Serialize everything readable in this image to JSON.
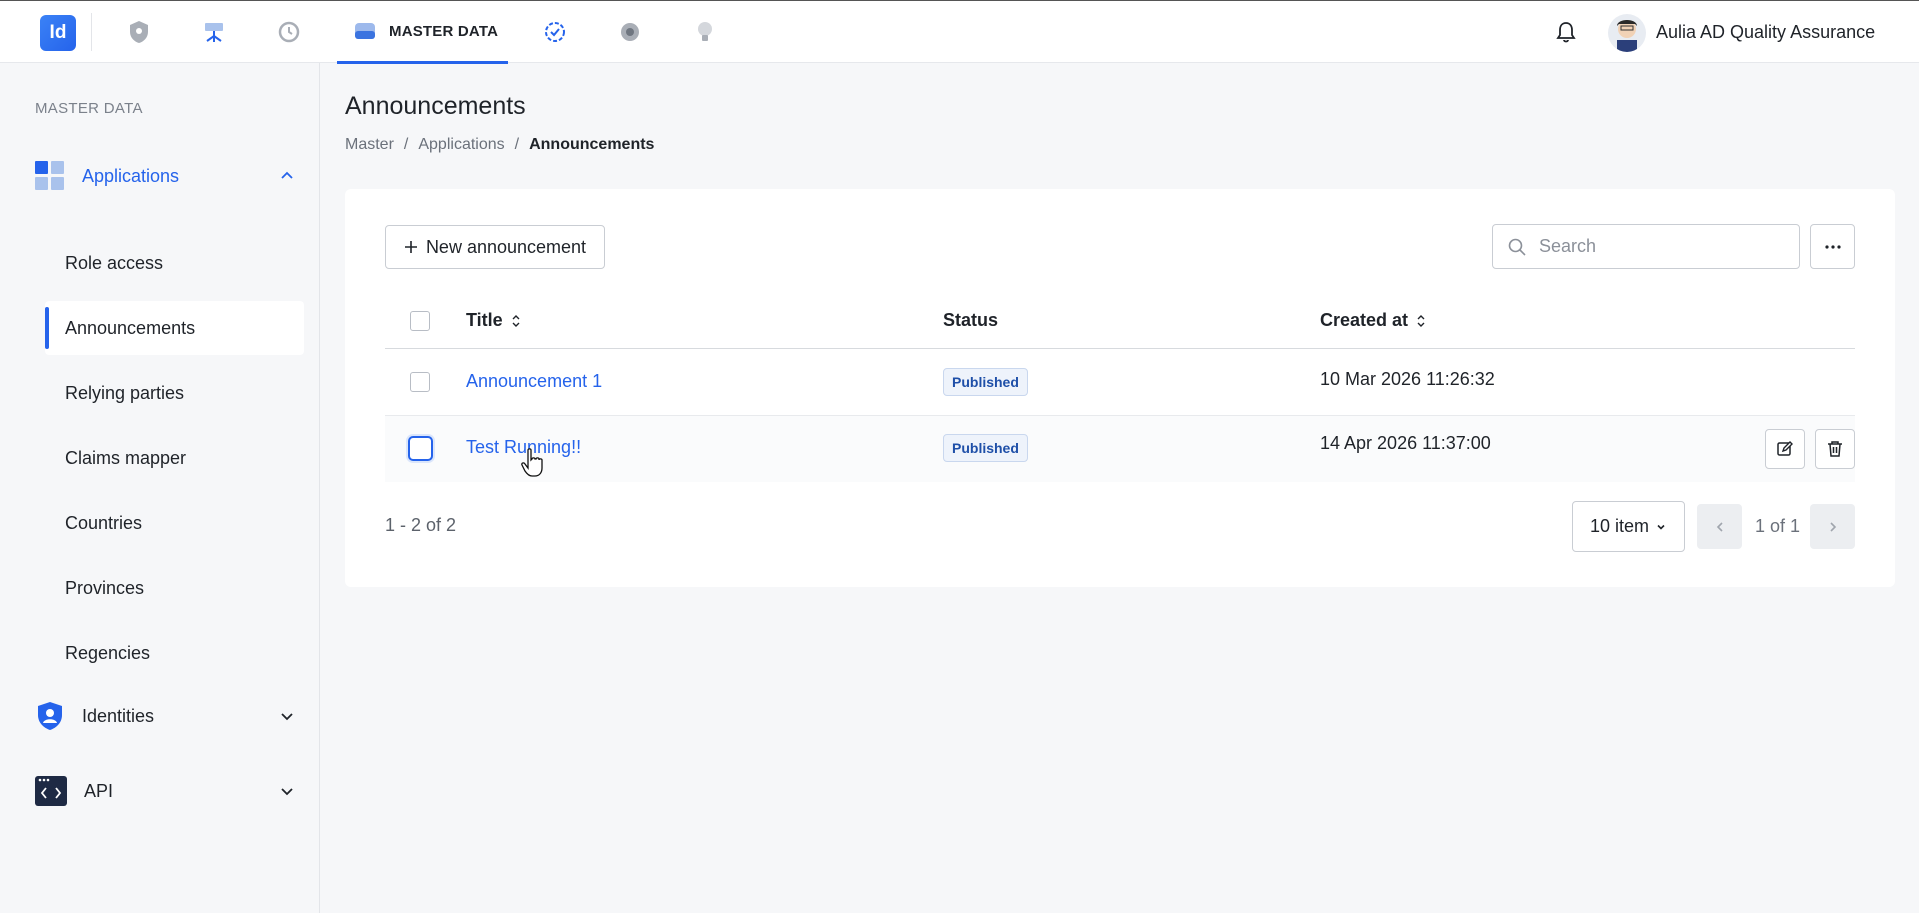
{
  "topbar": {
    "logo_text": "Id",
    "active_tab_label": "MASTER DATA",
    "nav_icons": [
      "shield-icon",
      "network-icon",
      "history-icon",
      "database-icon",
      "check-badge-icon",
      "settings-icon",
      "lightbulb-icon"
    ],
    "user_name": "Aulia AD Quality Assurance",
    "accent_color": "#2563eb"
  },
  "sidebar": {
    "header": "MASTER DATA",
    "groups": [
      {
        "label": "Applications",
        "icon": "applications-grid-icon",
        "expanded": true,
        "items": [
          {
            "label": "Role access"
          },
          {
            "label": "Announcements",
            "active": true
          },
          {
            "label": "Relying parties"
          },
          {
            "label": "Claims mapper"
          },
          {
            "label": "Countries"
          },
          {
            "label": "Provinces"
          },
          {
            "label": "Regencies"
          }
        ]
      },
      {
        "label": "Identities",
        "icon": "identity-shield-icon",
        "expanded": false
      },
      {
        "label": "API",
        "icon": "api-code-icon",
        "expanded": false
      }
    ]
  },
  "main": {
    "page_title": "Announcements",
    "breadcrumb": [
      "Master",
      "Applications",
      "Announcements"
    ],
    "new_button_label": "New announcement",
    "search_placeholder": "Search",
    "table": {
      "columns": [
        "Title",
        "Status",
        "Created at"
      ],
      "rows": [
        {
          "title": "Announcement 1",
          "status": "Published",
          "created_at": "10 Mar 2026 11:26:32"
        },
        {
          "title": "Test Running!!",
          "status": "Published",
          "created_at": "14 Apr 2026 11:37:00"
        }
      ]
    },
    "pagination": {
      "range_text": "1 - 2 of 2",
      "page_size_label": "10 item",
      "page_info": "1 of 1"
    }
  }
}
